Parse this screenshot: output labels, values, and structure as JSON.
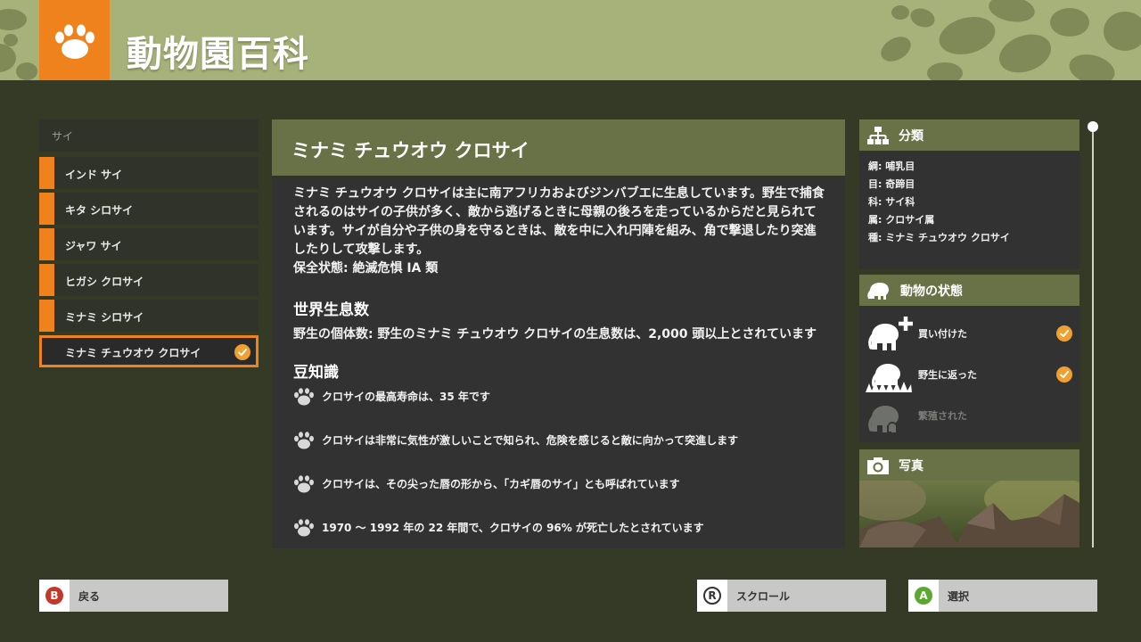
{
  "header": {
    "title": "動物園百科",
    "badge_icon": "paw-icon"
  },
  "list": {
    "category": "サイ",
    "items": [
      {
        "label": "インド サイ"
      },
      {
        "label": "キタ シロサイ"
      },
      {
        "label": "ジャワ サイ"
      },
      {
        "label": "ヒガシ クロサイ"
      },
      {
        "label": "ミナミ シロサイ"
      },
      {
        "label": "ミナミ チュウオウ クロサイ",
        "selected": true
      }
    ]
  },
  "detail": {
    "title": "ミナミ チュウオウ クロサイ",
    "description": "ミナミ チュウオウ クロサイは主に南アフリカおよびジンバブエに生息しています。野生で捕食されるのはサイの子供が多く、敵から逃げるときに母親の後ろを走っているからだと見られています。サイが自分や子供の身を守るときは、敵を中に入れ円陣を組み、角で撃退したり突進したりして攻撃します。",
    "conservation": "保全状態: 絶滅危惧 IA 類",
    "population_heading": "世界生息数",
    "population_text": "野生の個体数: 野生のミナミ チュウオウ クロサイの生息数は、2,000 頭以上とされています",
    "trivia_heading": "豆知識",
    "trivia": [
      "クロサイの最高寿命は、35 年です",
      "クロサイは非常に気性が激しいことで知られ、危険を感じると敵に向かって突進します",
      "クロサイは、その尖った唇の形から、「カギ唇のサイ」とも呼ばれています",
      "1970 ～ 1992 年の 22 年間で、クロサイの 96% が死亡したとされています"
    ]
  },
  "classification": {
    "heading": "分類",
    "rows": [
      "綱: 哺乳目",
      "目: 奇蹄目",
      "科: サイ科",
      "属: クロサイ属",
      "種: ミナミ チュウオウ クロサイ"
    ]
  },
  "status": {
    "heading": "動物の状態",
    "items": [
      {
        "label": "買い付けた",
        "done": true,
        "icon": "elephant-plus-icon"
      },
      {
        "label": "野生に返った",
        "done": true,
        "icon": "elephant-grass-icon"
      },
      {
        "label": "繁殖された",
        "done": false,
        "icon": "elephant-baby-icon"
      }
    ]
  },
  "photo": {
    "heading": "写真"
  },
  "footer": {
    "back": {
      "key": "B",
      "label": "戻る",
      "color": "#c0392b"
    },
    "scroll": {
      "key": "R",
      "label": "スクロール"
    },
    "select": {
      "key": "A",
      "label": "選択",
      "color": "#5aa832"
    }
  },
  "colors": {
    "accent": "#f0821e",
    "panel_header": "#697246",
    "header_bg": "#a7b17a",
    "background": "#353a26"
  }
}
